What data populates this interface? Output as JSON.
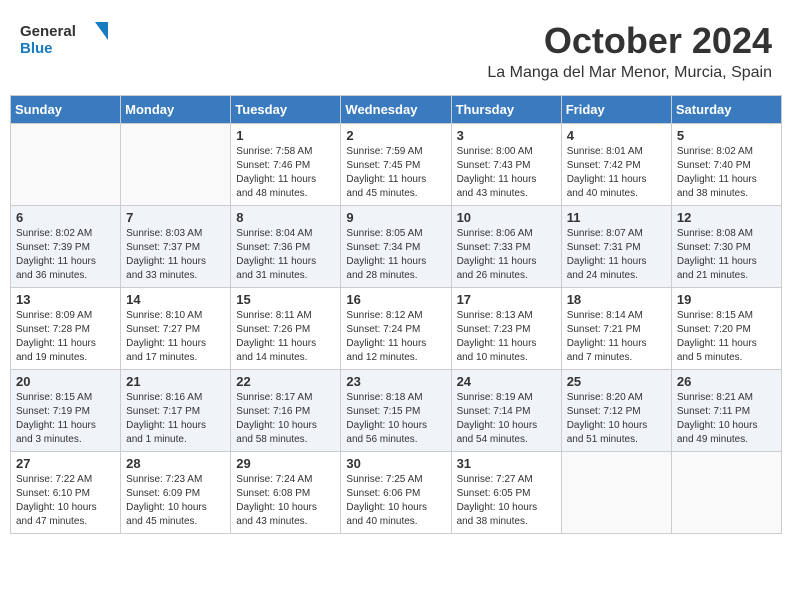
{
  "logo": {
    "line1": "General",
    "line2": "Blue"
  },
  "title": "October 2024",
  "location": "La Manga del Mar Menor, Murcia, Spain",
  "weekdays": [
    "Sunday",
    "Monday",
    "Tuesday",
    "Wednesday",
    "Thursday",
    "Friday",
    "Saturday"
  ],
  "days": [
    {
      "date": "",
      "info": ""
    },
    {
      "date": "",
      "info": ""
    },
    {
      "date": "1",
      "info": "Sunrise: 7:58 AM\nSunset: 7:46 PM\nDaylight: 11 hours and 48 minutes."
    },
    {
      "date": "2",
      "info": "Sunrise: 7:59 AM\nSunset: 7:45 PM\nDaylight: 11 hours and 45 minutes."
    },
    {
      "date": "3",
      "info": "Sunrise: 8:00 AM\nSunset: 7:43 PM\nDaylight: 11 hours and 43 minutes."
    },
    {
      "date": "4",
      "info": "Sunrise: 8:01 AM\nSunset: 7:42 PM\nDaylight: 11 hours and 40 minutes."
    },
    {
      "date": "5",
      "info": "Sunrise: 8:02 AM\nSunset: 7:40 PM\nDaylight: 11 hours and 38 minutes."
    },
    {
      "date": "6",
      "info": "Sunrise: 8:02 AM\nSunset: 7:39 PM\nDaylight: 11 hours and 36 minutes."
    },
    {
      "date": "7",
      "info": "Sunrise: 8:03 AM\nSunset: 7:37 PM\nDaylight: 11 hours and 33 minutes."
    },
    {
      "date": "8",
      "info": "Sunrise: 8:04 AM\nSunset: 7:36 PM\nDaylight: 11 hours and 31 minutes."
    },
    {
      "date": "9",
      "info": "Sunrise: 8:05 AM\nSunset: 7:34 PM\nDaylight: 11 hours and 28 minutes."
    },
    {
      "date": "10",
      "info": "Sunrise: 8:06 AM\nSunset: 7:33 PM\nDaylight: 11 hours and 26 minutes."
    },
    {
      "date": "11",
      "info": "Sunrise: 8:07 AM\nSunset: 7:31 PM\nDaylight: 11 hours and 24 minutes."
    },
    {
      "date": "12",
      "info": "Sunrise: 8:08 AM\nSunset: 7:30 PM\nDaylight: 11 hours and 21 minutes."
    },
    {
      "date": "13",
      "info": "Sunrise: 8:09 AM\nSunset: 7:28 PM\nDaylight: 11 hours and 19 minutes."
    },
    {
      "date": "14",
      "info": "Sunrise: 8:10 AM\nSunset: 7:27 PM\nDaylight: 11 hours and 17 minutes."
    },
    {
      "date": "15",
      "info": "Sunrise: 8:11 AM\nSunset: 7:26 PM\nDaylight: 11 hours and 14 minutes."
    },
    {
      "date": "16",
      "info": "Sunrise: 8:12 AM\nSunset: 7:24 PM\nDaylight: 11 hours and 12 minutes."
    },
    {
      "date": "17",
      "info": "Sunrise: 8:13 AM\nSunset: 7:23 PM\nDaylight: 11 hours and 10 minutes."
    },
    {
      "date": "18",
      "info": "Sunrise: 8:14 AM\nSunset: 7:21 PM\nDaylight: 11 hours and 7 minutes."
    },
    {
      "date": "19",
      "info": "Sunrise: 8:15 AM\nSunset: 7:20 PM\nDaylight: 11 hours and 5 minutes."
    },
    {
      "date": "20",
      "info": "Sunrise: 8:15 AM\nSunset: 7:19 PM\nDaylight: 11 hours and 3 minutes."
    },
    {
      "date": "21",
      "info": "Sunrise: 8:16 AM\nSunset: 7:17 PM\nDaylight: 11 hours and 1 minute."
    },
    {
      "date": "22",
      "info": "Sunrise: 8:17 AM\nSunset: 7:16 PM\nDaylight: 10 hours and 58 minutes."
    },
    {
      "date": "23",
      "info": "Sunrise: 8:18 AM\nSunset: 7:15 PM\nDaylight: 10 hours and 56 minutes."
    },
    {
      "date": "24",
      "info": "Sunrise: 8:19 AM\nSunset: 7:14 PM\nDaylight: 10 hours and 54 minutes."
    },
    {
      "date": "25",
      "info": "Sunrise: 8:20 AM\nSunset: 7:12 PM\nDaylight: 10 hours and 51 minutes."
    },
    {
      "date": "26",
      "info": "Sunrise: 8:21 AM\nSunset: 7:11 PM\nDaylight: 10 hours and 49 minutes."
    },
    {
      "date": "27",
      "info": "Sunrise: 7:22 AM\nSunset: 6:10 PM\nDaylight: 10 hours and 47 minutes."
    },
    {
      "date": "28",
      "info": "Sunrise: 7:23 AM\nSunset: 6:09 PM\nDaylight: 10 hours and 45 minutes."
    },
    {
      "date": "29",
      "info": "Sunrise: 7:24 AM\nSunset: 6:08 PM\nDaylight: 10 hours and 43 minutes."
    },
    {
      "date": "30",
      "info": "Sunrise: 7:25 AM\nSunset: 6:06 PM\nDaylight: 10 hours and 40 minutes."
    },
    {
      "date": "31",
      "info": "Sunrise: 7:27 AM\nSunset: 6:05 PM\nDaylight: 10 hours and 38 minutes."
    },
    {
      "date": "",
      "info": ""
    },
    {
      "date": "",
      "info": ""
    }
  ]
}
